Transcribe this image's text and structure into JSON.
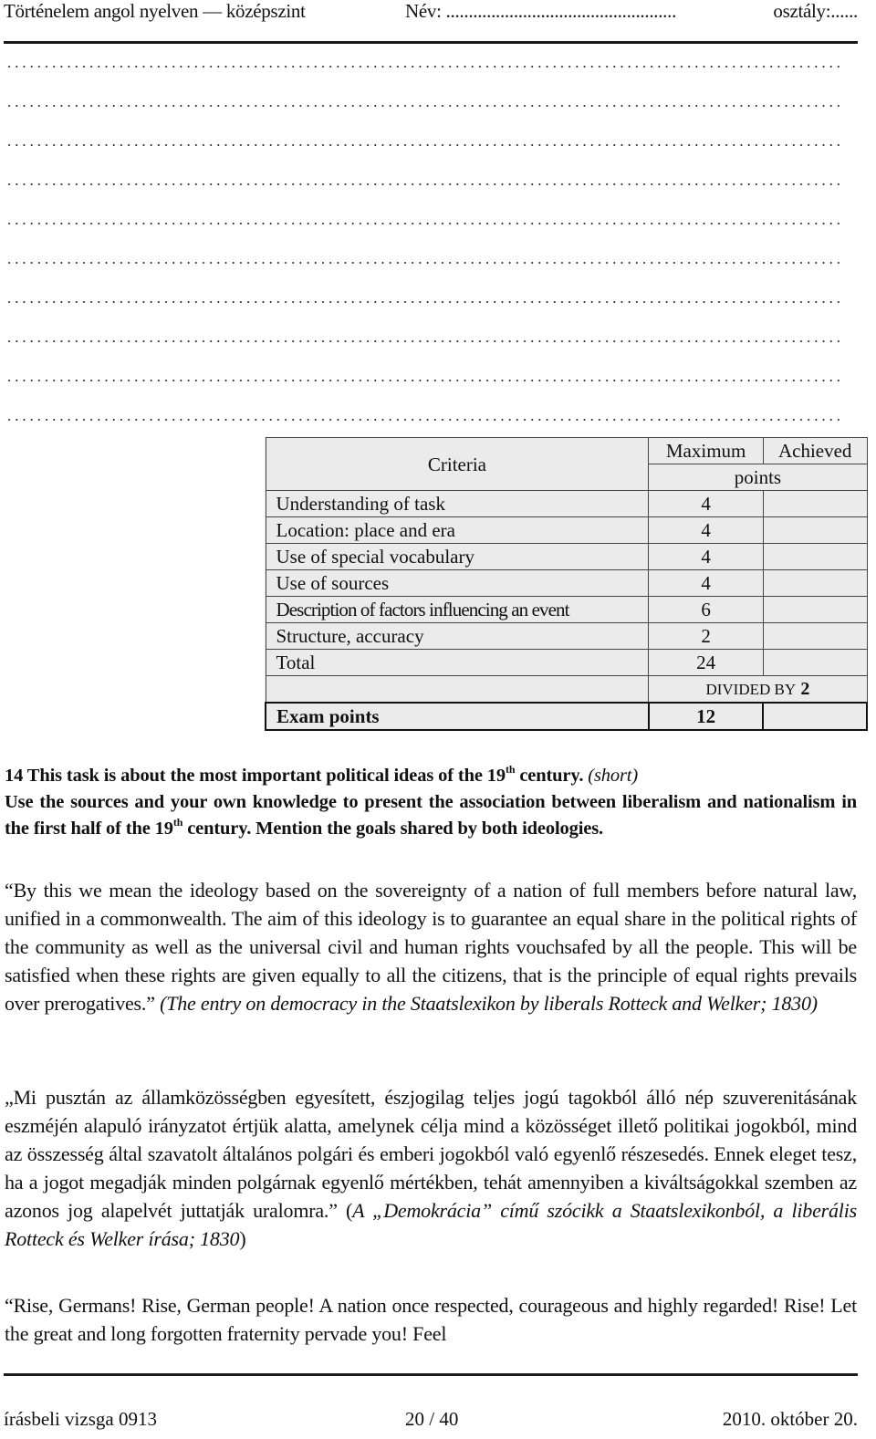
{
  "header": {
    "title": "Történelem angol nyelven — középszint",
    "name_label": "Név: ...................................................",
    "class_label": "osztály:......"
  },
  "answer_lines_count": 10,
  "criteria_table": {
    "header": {
      "criteria": "Criteria",
      "maximum": "Maximum",
      "achieved": "Achieved",
      "points": "points"
    },
    "rows": [
      {
        "criterion": "Understanding of task",
        "max": "4",
        "achieved": ""
      },
      {
        "criterion": "Location: place and era",
        "max": "4",
        "achieved": ""
      },
      {
        "criterion": "Use of special vocabulary",
        "max": "4",
        "achieved": ""
      },
      {
        "criterion": "Use of sources",
        "max": "4",
        "achieved": ""
      },
      {
        "criterion": "Description of factors influencing an event",
        "max": "6",
        "achieved": ""
      },
      {
        "criterion": "Structure, accuracy",
        "max": "2",
        "achieved": ""
      }
    ],
    "total": {
      "label": "Total",
      "max": "24",
      "achieved": ""
    },
    "divided_by": {
      "label": "DIVIDED BY",
      "value": "2"
    },
    "exam_points": {
      "label": "Exam points",
      "max": "12",
      "achieved": ""
    }
  },
  "task": {
    "line1_pre": "14 This task is about the most important political ideas of the 19",
    "sup": "th",
    "line1_post": " century. ",
    "short": "(short)",
    "line2_pre": "Use the sources and your own knowledge to present the association between liberalism and nationalism in the first half of the 19",
    "line2_post": " century. Mention the goals shared by both ideologies."
  },
  "sources": {
    "s1_quote": "“By this we mean the ideology based on the sovereignty of a nation of full members before natural law, unified in a commonwealth. The aim of this ideology is to guarantee an equal share in the political rights of the community as well as the universal civil and human rights vouchsafed by all the people. This will be satisfied when these rights are given equally to all the citizens, that is the principle of equal rights prevails over prerogatives.” ",
    "s1_cite": "(The entry on democracy in the Staatslexikon by liberals Rotteck and Welker; 1830)",
    "s2_quote": "„Mi pusztán az államközösségben egyesített, észjogilag teljes jogú tagokból álló nép szuverenitásának eszméjén alapuló irányzatot értjük alatta, amelynek célja mind a közösséget illető politikai jogokból, mind az összesség által szavatolt általános polgári és emberi jogokból való egyenlő részesedés. Ennek eleget tesz, ha a jogot megadják minden polgárnak egyenlő mértékben, tehát amennyiben a kiváltságokkal szemben az azonos jog alapelvét juttatják uralomra.” (",
    "s2_cite": "A „Demokrácia” című szócikk a Staatslexikonból, a liberális Rotteck és Welker írása; 1830",
    "s2_close": ")",
    "s3_quote": "“Rise, Germans! Rise, German people! A nation once respected, courageous and highly regarded! Rise! Let the great and long forgotten fraternity pervade you! Feel"
  },
  "footer": {
    "left": "írásbeli vizsga 0913",
    "center": "20 / 40",
    "right": "2010. október 20."
  }
}
